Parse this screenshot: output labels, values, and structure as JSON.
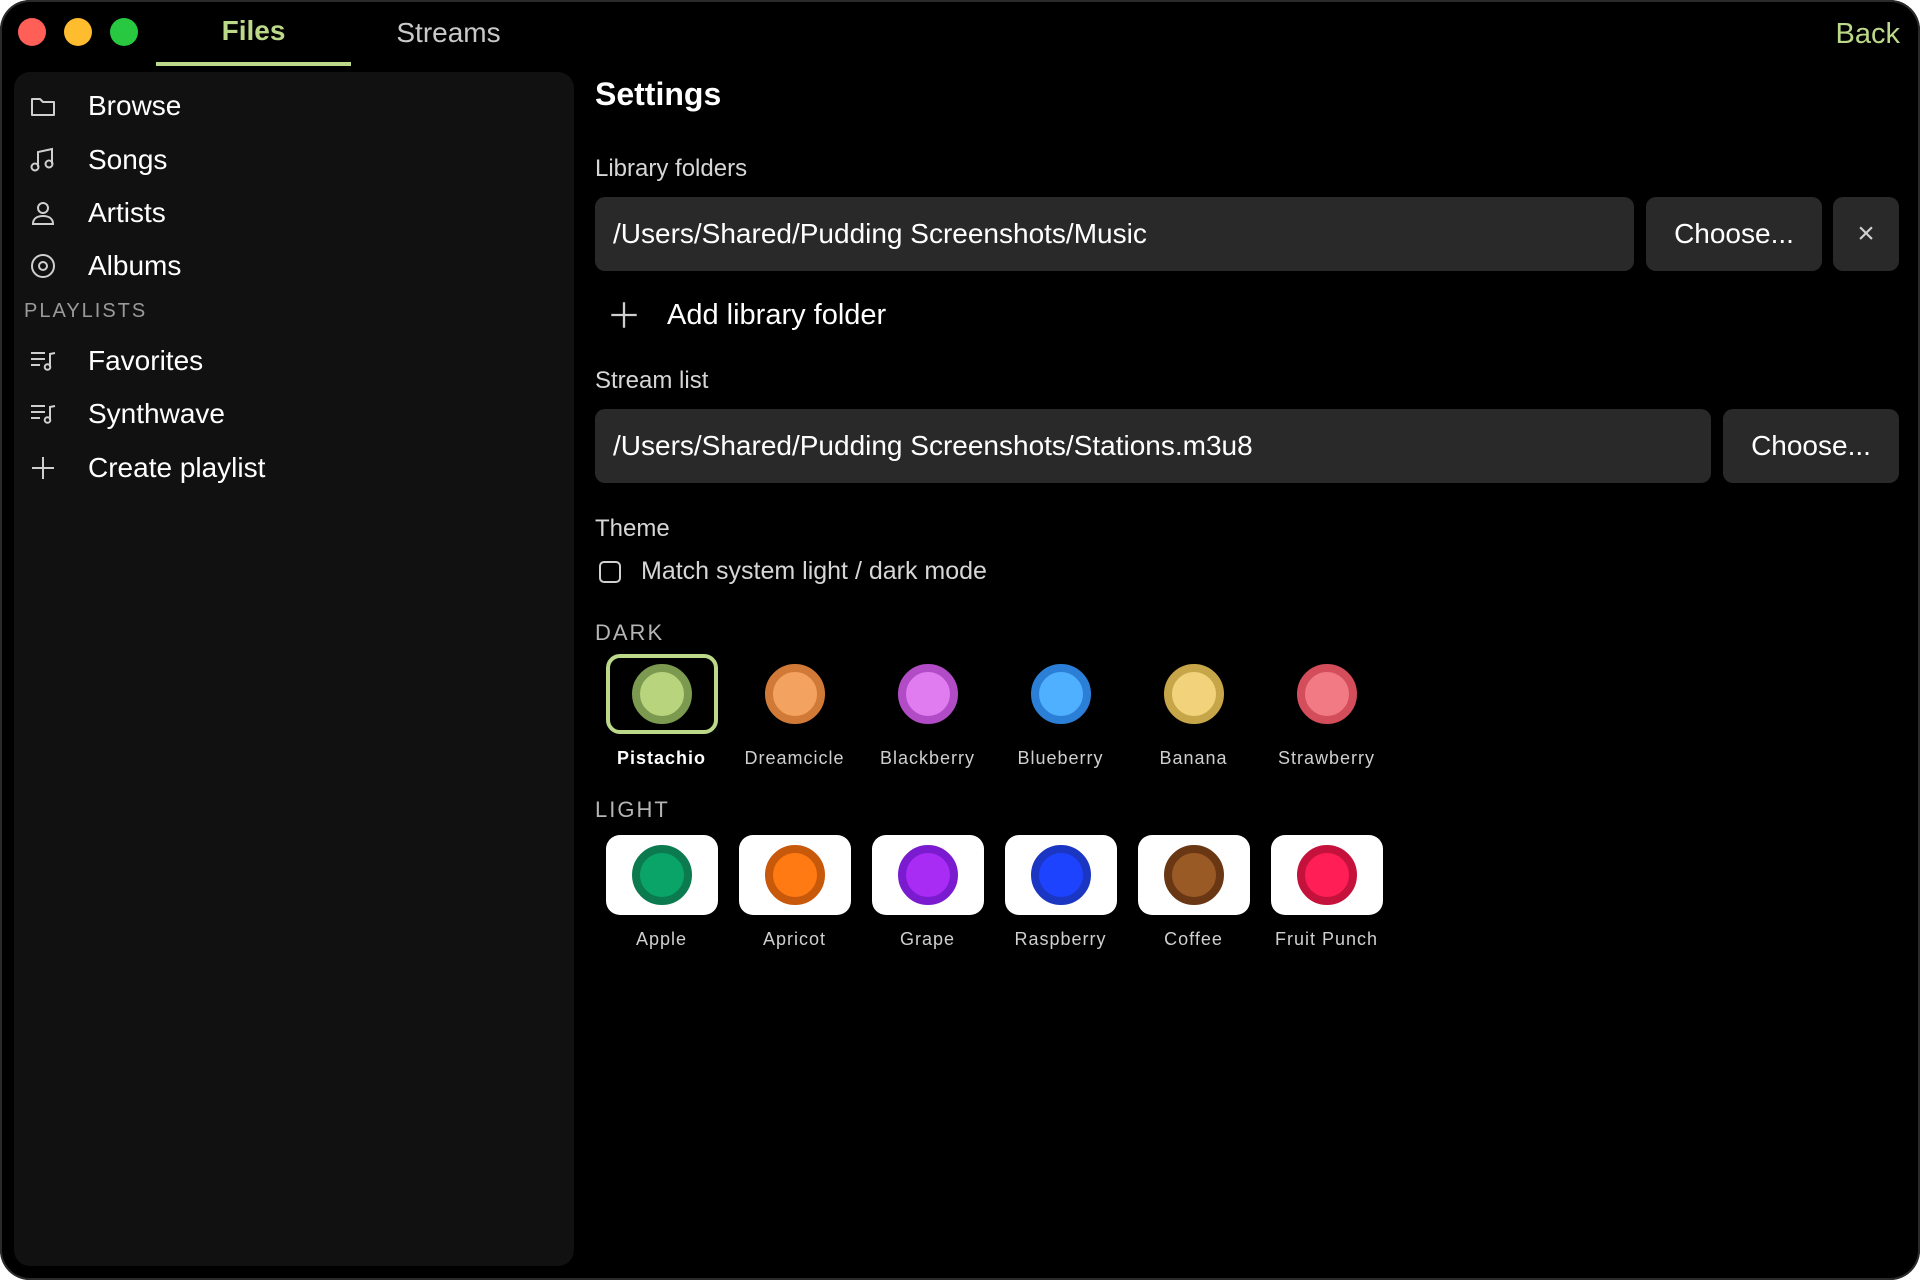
{
  "tabs": [
    {
      "label": "Files",
      "active": true
    },
    {
      "label": "Streams",
      "active": false
    }
  ],
  "back_label": "Back",
  "sidebar": {
    "items": [
      {
        "label": "Browse",
        "icon": "folder-icon"
      },
      {
        "label": "Songs",
        "icon": "music-note-icon"
      },
      {
        "label": "Artists",
        "icon": "person-icon"
      },
      {
        "label": "Albums",
        "icon": "disc-icon"
      }
    ],
    "playlists_heading": "PLAYLISTS",
    "playlists": [
      {
        "label": "Favorites",
        "icon": "playlist-icon"
      },
      {
        "label": "Synthwave",
        "icon": "playlist-icon"
      }
    ],
    "create_playlist": "Create playlist"
  },
  "settings": {
    "title": "Settings",
    "library_label": "Library folders",
    "library_path": "/Users/Shared/Pudding Screenshots/Music",
    "choose_label": "Choose...",
    "remove_label": "×",
    "add_folder_label": "Add library folder",
    "stream_label": "Stream list",
    "stream_path": "/Users/Shared/Pudding Screenshots/Stations.m3u8",
    "theme_label": "Theme",
    "match_system_label": "Match system light / dark mode",
    "match_system_checked": false,
    "dark_heading": "DARK",
    "light_heading": "LIGHT",
    "dark_themes": [
      {
        "name": "Pistachio",
        "ring": "#7c9a4f",
        "fill": "#b8d47c",
        "selected": true
      },
      {
        "name": "Dreamcicle",
        "ring": "#d17a37",
        "fill": "#f3a35f",
        "selected": false
      },
      {
        "name": "Blackberry",
        "ring": "#b14cc6",
        "fill": "#e07cf0",
        "selected": false
      },
      {
        "name": "Blueberry",
        "ring": "#2b7fd6",
        "fill": "#4fb0ff",
        "selected": false
      },
      {
        "name": "Banana",
        "ring": "#c7a649",
        "fill": "#f2d37c",
        "selected": false
      },
      {
        "name": "Strawberry",
        "ring": "#d34d5a",
        "fill": "#f27a85",
        "selected": false
      }
    ],
    "light_themes": [
      {
        "name": "Apple",
        "ring": "#0b7a4e",
        "fill": "#0aa469"
      },
      {
        "name": "Apricot",
        "ring": "#c8580a",
        "fill": "#ff7a12"
      },
      {
        "name": "Grape",
        "ring": "#7a1bcf",
        "fill": "#a92cf5"
      },
      {
        "name": "Raspberry",
        "ring": "#1a36c2",
        "fill": "#1d43ff"
      },
      {
        "name": "Coffee",
        "ring": "#6a3714",
        "fill": "#9a5a26"
      },
      {
        "name": "Fruit Punch",
        "ring": "#c5123c",
        "fill": "#ff1e56"
      }
    ]
  },
  "colors": {
    "accent": "#bcd98a",
    "background": "#000000",
    "sidebar": "#111111",
    "field": "#292929"
  }
}
